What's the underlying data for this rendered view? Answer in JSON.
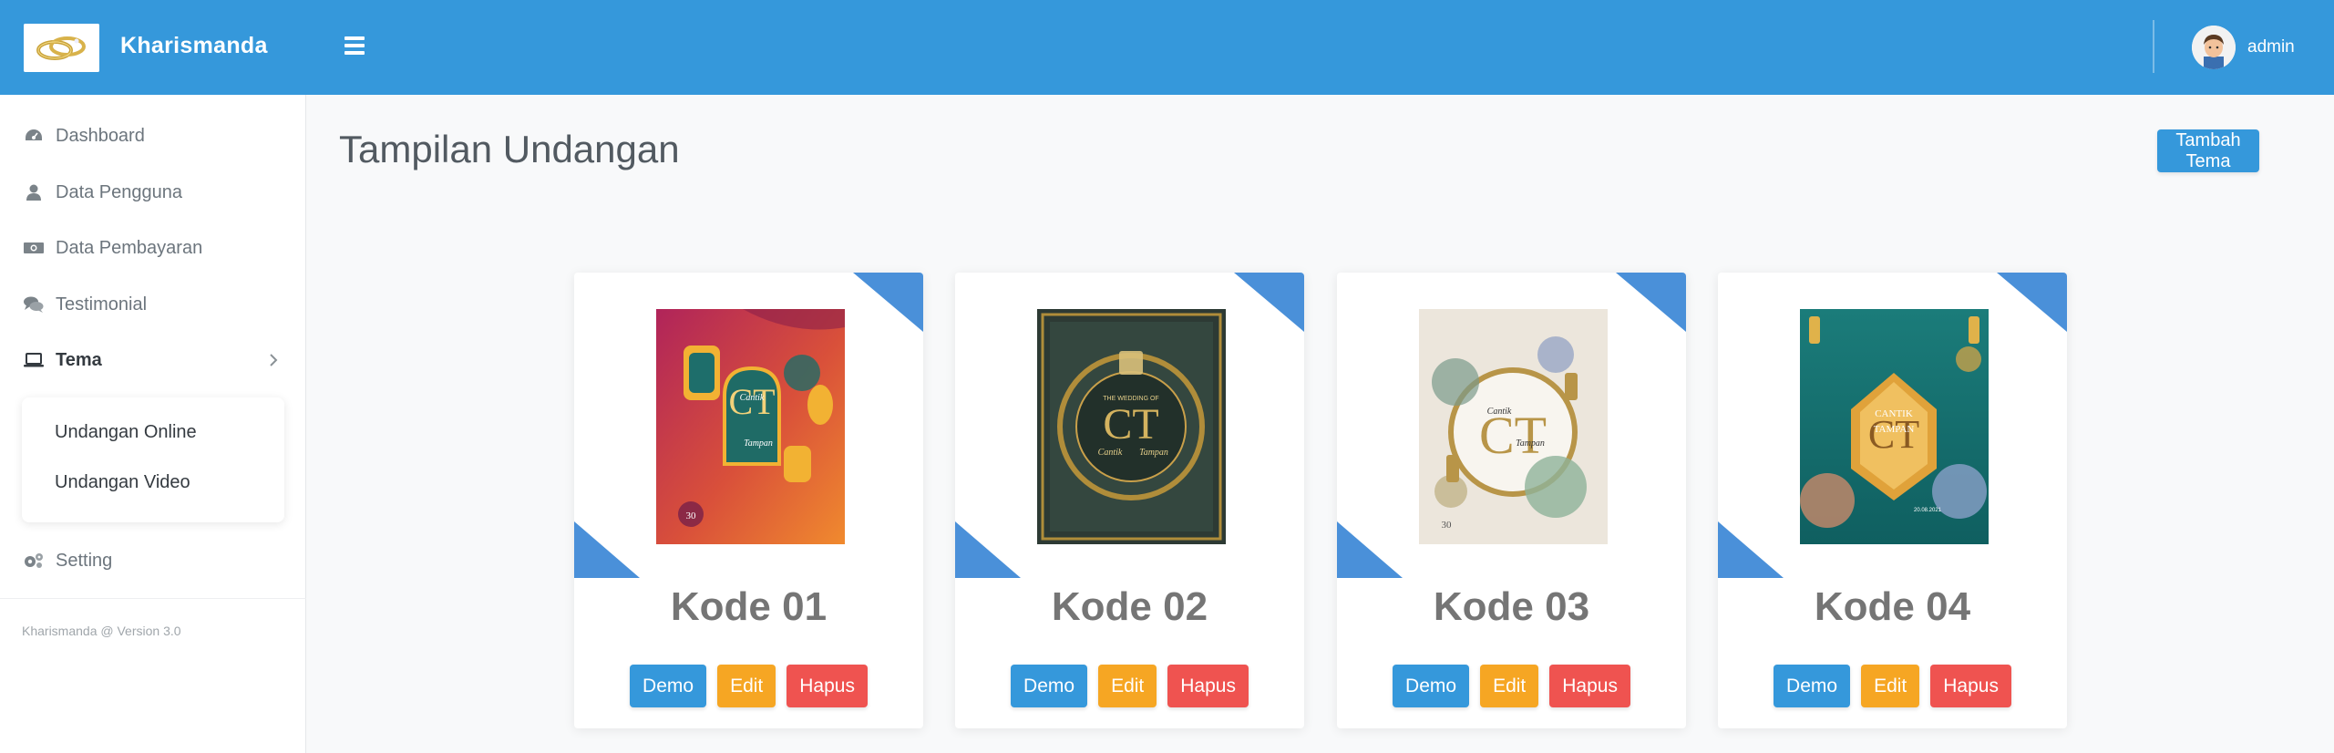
{
  "header": {
    "brand": "Kharismanda",
    "username": "admin"
  },
  "sidebar": {
    "items": [
      {
        "label": "Dashboard",
        "icon": "dashboard-icon"
      },
      {
        "label": "Data Pengguna",
        "icon": "user-icon"
      },
      {
        "label": "Data Pembayaran",
        "icon": "money-icon"
      },
      {
        "label": "Testimonial",
        "icon": "comments-icon"
      },
      {
        "label": "Tema",
        "icon": "laptop-icon"
      },
      {
        "label": "Setting",
        "icon": "gears-icon"
      }
    ],
    "submenu": [
      "Undangan Online",
      "Undangan Video"
    ],
    "version": "Kharismanda @ Version 3.0"
  },
  "main": {
    "title": "Tampilan Undangan",
    "add_button": "Tambah Tema",
    "cards": [
      {
        "title": "Kode 01",
        "demo": "Demo",
        "edit": "Edit",
        "hapus": "Hapus",
        "thumb_text_1": "Cantik",
        "thumb_text_2": "Tampan",
        "thumb_mono": "CT",
        "thumb_number": "30"
      },
      {
        "title": "Kode 02",
        "demo": "Demo",
        "edit": "Edit",
        "hapus": "Hapus",
        "thumb_text_1": "Cantik",
        "thumb_text_2": "Tampan",
        "thumb_mono": "CT",
        "thumb_small": "THE WEDDING OF"
      },
      {
        "title": "Kode 03",
        "demo": "Demo",
        "edit": "Edit",
        "hapus": "Hapus",
        "thumb_text_1": "Cantik",
        "thumb_text_2": "Tampan",
        "thumb_mono": "CT",
        "thumb_number": "30"
      },
      {
        "title": "Kode 04",
        "demo": "Demo",
        "edit": "Edit",
        "hapus": "Hapus",
        "thumb_text_1": "CANTIK",
        "thumb_text_2": "TAMPAN",
        "thumb_mono": "CT",
        "thumb_date": "20.08.2021"
      }
    ]
  },
  "colors": {
    "primary": "#3598db",
    "warning": "#f6a623",
    "danger": "#ef5350",
    "corner": "#4a90d9"
  }
}
